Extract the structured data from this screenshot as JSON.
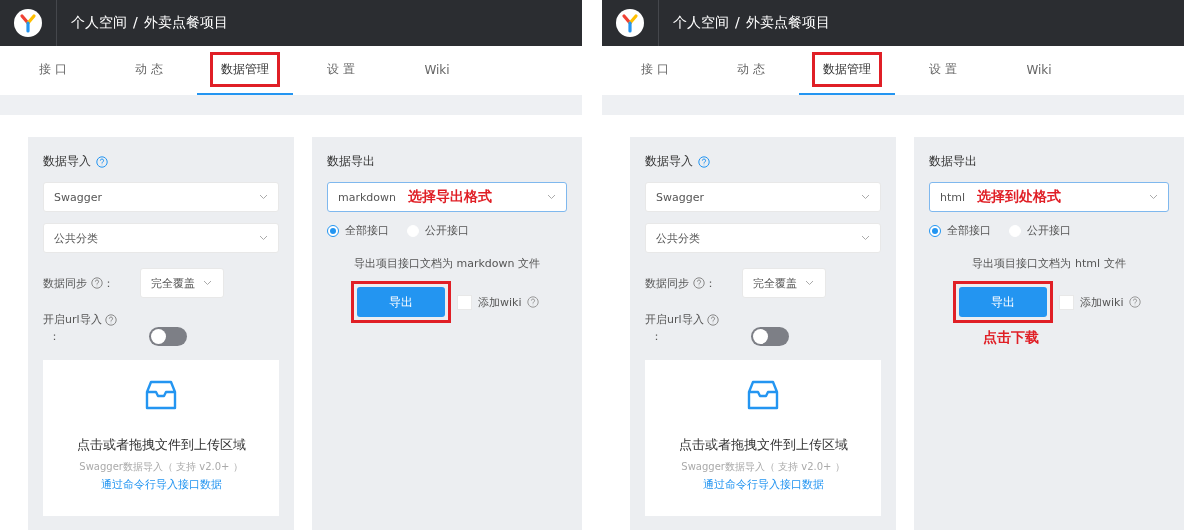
{
  "panes": [
    {
      "header": {
        "space": "个人空间",
        "separator": "/",
        "project": "外卖点餐项目"
      },
      "tabs": [
        {
          "label": "接 口",
          "selected": false,
          "highlighted": false
        },
        {
          "label": "动 态",
          "selected": false,
          "highlighted": false
        },
        {
          "label": "数据管理",
          "selected": true,
          "highlighted": true
        },
        {
          "label": "设 置",
          "selected": false,
          "highlighted": false
        },
        {
          "label": "Wiki",
          "selected": false,
          "highlighted": false
        }
      ],
      "import": {
        "title": "数据导入",
        "source": "Swagger",
        "category": "公共分类",
        "sync_label": "数据同步",
        "sync_colon": "：",
        "sync_mode": "完全覆盖",
        "url_label": "开启url导入",
        "url_colon": "：",
        "url_on": false,
        "upload_text": "点击或者拖拽文件到上传区域",
        "upload_hint": "Swagger数据导入（ 支持 v2.0+ ）",
        "upload_link": "通过命令行导入接口数据"
      },
      "export": {
        "title": "数据导出",
        "format": "markdown",
        "format_note": "选择导出格式",
        "scopes": [
          {
            "label": "全部接口",
            "selected": true
          },
          {
            "label": "公开接口",
            "selected": false
          }
        ],
        "description": "导出项目接口文档为 markdown 文件",
        "button": "导出",
        "button_highlighted": true,
        "wiki_label": "添加wiki",
        "wiki_checked": false
      }
    },
    {
      "header": {
        "space": "个人空间",
        "separator": "/",
        "project": "外卖点餐项目"
      },
      "tabs": [
        {
          "label": "接 口",
          "selected": false,
          "highlighted": false
        },
        {
          "label": "动 态",
          "selected": false,
          "highlighted": false
        },
        {
          "label": "数据管理",
          "selected": true,
          "highlighted": true
        },
        {
          "label": "设 置",
          "selected": false,
          "highlighted": false
        },
        {
          "label": "Wiki",
          "selected": false,
          "highlighted": false
        }
      ],
      "import": {
        "title": "数据导入",
        "source": "Swagger",
        "category": "公共分类",
        "sync_label": "数据同步",
        "sync_colon": "：",
        "sync_mode": "完全覆盖",
        "url_label": "开启url导入",
        "url_colon": "：",
        "url_on": false,
        "upload_text": "点击或者拖拽文件到上传区域",
        "upload_hint": "Swagger数据导入（ 支持 v2.0+ ）",
        "upload_link": "通过命令行导入接口数据"
      },
      "export": {
        "title": "数据导出",
        "format": "html",
        "format_note": "选择到处格式",
        "scopes": [
          {
            "label": "全部接口",
            "selected": true
          },
          {
            "label": "公开接口",
            "selected": false
          }
        ],
        "description": "导出项目接口文档为 html 文件",
        "button": "导出",
        "button_highlighted": true,
        "wiki_label": "添加wiki",
        "wiki_checked": false,
        "callout": "点击下载"
      }
    }
  ]
}
